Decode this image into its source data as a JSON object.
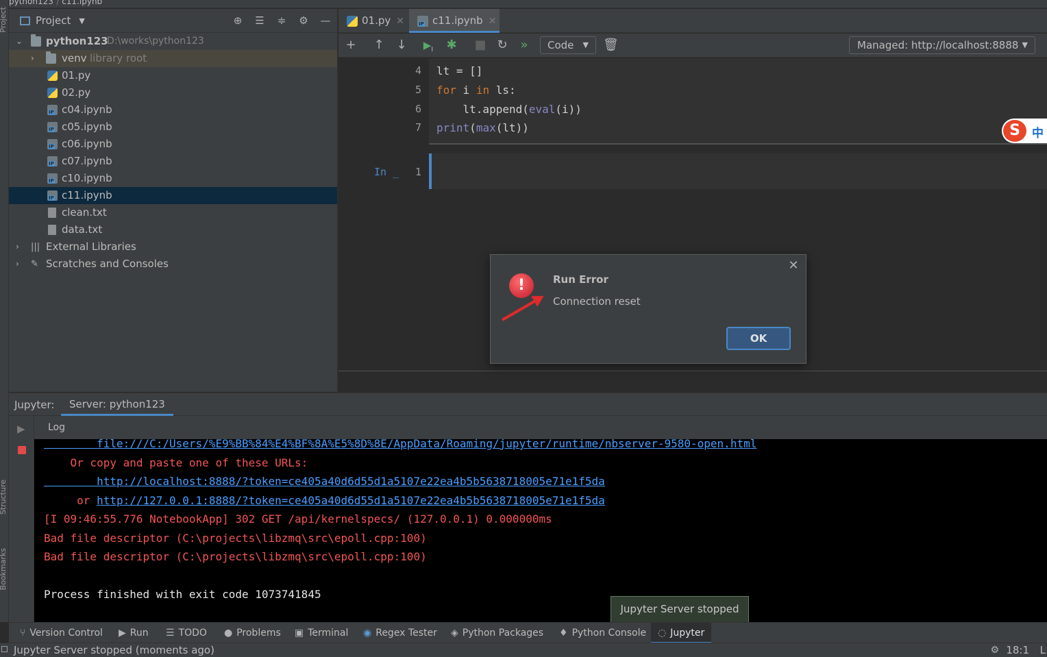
{
  "breadcrumb": {
    "project": "python123",
    "file": "c11.ipynb"
  },
  "side_labels": {
    "project": "Project",
    "structure": "Structure",
    "bookmarks": "Bookmarks"
  },
  "project_panel": {
    "title": "Project",
    "root": {
      "name": "python123",
      "path": "D:\\works\\python123"
    },
    "venv": {
      "name": "venv",
      "hint": "library root"
    },
    "files": [
      "01.py",
      "02.py",
      "c04.ipynb",
      "c05.ipynb",
      "c06.ipynb",
      "c07.ipynb",
      "c10.ipynb",
      "c11.ipynb",
      "clean.txt",
      "data.txt"
    ],
    "external_libraries": "External Libraries",
    "scratches": "Scratches and Consoles",
    "selected_file": "c11.ipynb"
  },
  "tabs": [
    {
      "label": "01.py",
      "active": false
    },
    {
      "label": "c11.ipynb",
      "active": true
    }
  ],
  "notebook_toolbar": {
    "cell_type": "Code",
    "server": "Managed: http://localhost:8888"
  },
  "cell1": {
    "lines": [
      {
        "num": "4",
        "text": "lt = []"
      },
      {
        "num": "5",
        "kw1": "for",
        "mid1": " i ",
        "kw2": "in",
        "rest": " ls:"
      },
      {
        "num": "6",
        "pre": "    lt.append(",
        "bi": "eval",
        "post": "(i))"
      },
      {
        "num": "7",
        "bi1": "print",
        "p1": "(",
        "bi2": "max",
        "p2": "(lt))"
      }
    ]
  },
  "cell2": {
    "prompt": "In _",
    "line_num": "1"
  },
  "ime": {
    "logo": "S",
    "mode": "中"
  },
  "dialog": {
    "title": "Run Error",
    "message": "Connection reset",
    "ok_label": "OK"
  },
  "jupyter_panel": {
    "label": "Jupyter:",
    "tab": "Server: python123",
    "log_tab": "Log"
  },
  "console": {
    "lines": [
      {
        "text": "        file:///C:/Users/%E9%BB%84%E4%BF%8A%E5%8D%8E/AppData/Roaming/jupyter/runtime/nbserver-9580-open.html",
        "style": "link"
      },
      {
        "text": "    Or copy and paste one of these URLs:",
        "style": "red"
      },
      {
        "text": "        http://localhost:8888/?token=ce405a40d6d55d1a5107e22ea4b5b5638718005e71e1f5da",
        "style": "link"
      },
      {
        "text": "     or http://127.0.0.1:8888/?token=ce405a40d6d55d1a5107e22ea4b5b5638718005e71e1f5da",
        "style": "mixed"
      },
      {
        "text": "[I 09:46:55.776 NotebookApp] 302 GET /api/kernelspecs/ (127.0.0.1) 0.000000ms",
        "style": "red"
      },
      {
        "text": "Bad file descriptor (C:\\projects\\libzmq\\src\\epoll.cpp:100)",
        "style": "red"
      },
      {
        "text": "Bad file descriptor (C:\\projects\\libzmq\\src\\epoll.cpp:100)",
        "style": "red"
      },
      {
        "text": "",
        "style": "white"
      },
      {
        "text": "Process finished with exit code 1073741845",
        "style": "white"
      }
    ],
    "or_prefix": "     or ",
    "or_link": "http://127.0.0.1:8888/?token=ce405a40d6d55d1a5107e22ea4b5b5638718005e71e1f5da"
  },
  "tooltip": "Jupyter Server stopped",
  "bottom_tools": [
    {
      "label": "Version Control",
      "icon": "branch-icon"
    },
    {
      "label": "Run",
      "icon": "play-icon"
    },
    {
      "label": "TODO",
      "icon": "list-icon"
    },
    {
      "label": "Problems",
      "icon": "info-icon"
    },
    {
      "label": "Terminal",
      "icon": "terminal-icon"
    },
    {
      "label": "Regex Tester",
      "icon": "regex-icon"
    },
    {
      "label": "Python Packages",
      "icon": "layers-icon"
    },
    {
      "label": "Python Console",
      "icon": "python-icon"
    },
    {
      "label": "Jupyter",
      "icon": "spinner-icon",
      "active": true
    }
  ],
  "status": {
    "message": "Jupyter Server stopped (moments ago)",
    "position": "18:1",
    "extra": "L"
  }
}
